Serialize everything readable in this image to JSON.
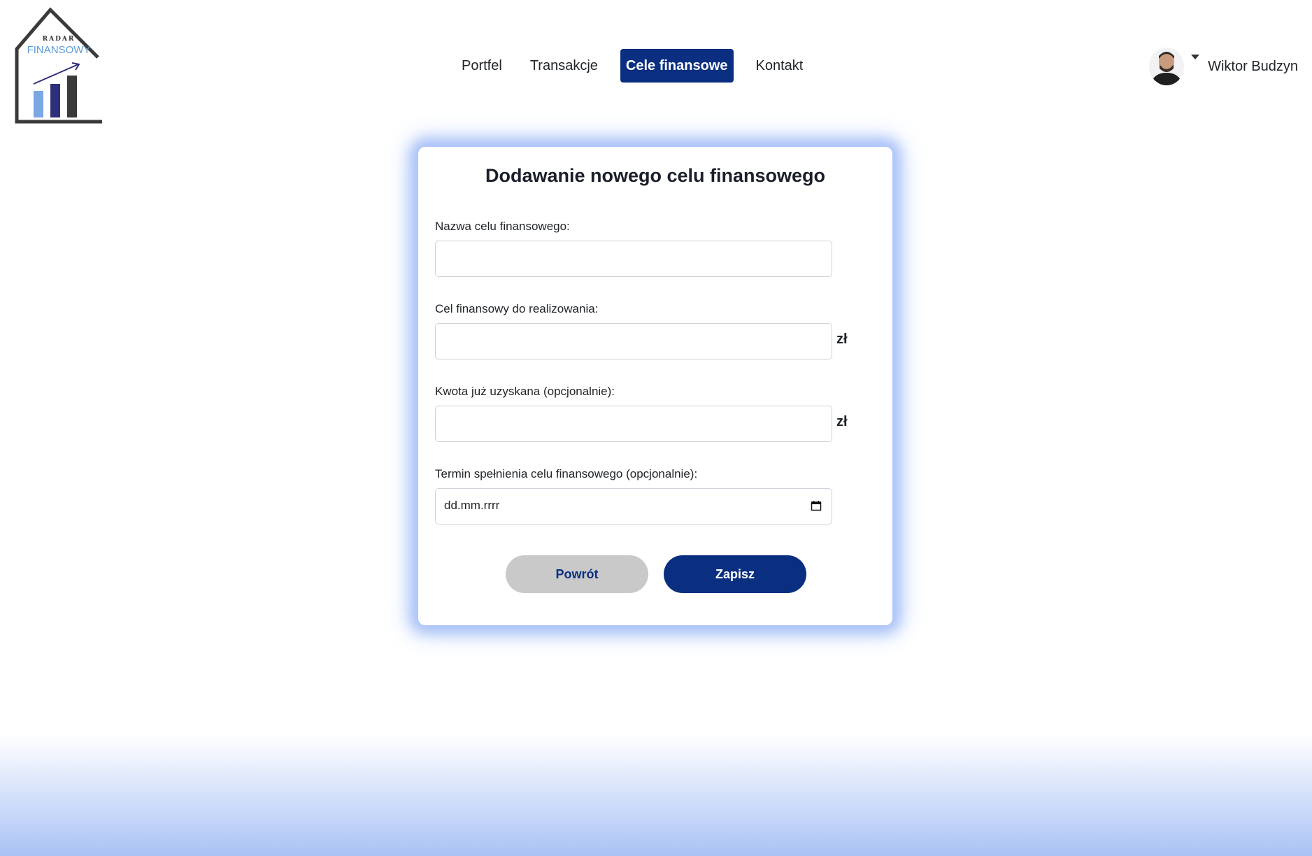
{
  "brand": {
    "logo_top_text": "RADAR",
    "logo_main_text": "FINANSOWY"
  },
  "nav": {
    "items": [
      {
        "label": "Portfel",
        "active": false
      },
      {
        "label": "Transakcje",
        "active": false
      },
      {
        "label": "Cele finansowe",
        "active": true
      },
      {
        "label": "Kontakt",
        "active": false
      }
    ]
  },
  "user": {
    "name": "Wiktor Budzyn",
    "avatar_icon": "user-avatar",
    "menu_icon": "caret-down-icon"
  },
  "form": {
    "title": "Dodawanie nowego celu finansowego",
    "goal_name": {
      "label": "Nazwa celu finansowego:",
      "value": ""
    },
    "target_amount": {
      "label": "Cel finansowy do realizowania:",
      "value": "",
      "currency": "zł"
    },
    "obtained_amount": {
      "label": "Kwota już uzyskana (opcjonalnie):",
      "value": "",
      "currency": "zł"
    },
    "deadline": {
      "label": "Termin spełnienia celu finansowego (opcjonalnie):",
      "placeholder": "dd.mm.rrrr",
      "icon": "calendar-icon"
    },
    "back_label": "Powrót",
    "save_label": "Zapisz"
  },
  "colors": {
    "primary": "#0a2f80",
    "secondary_button": "#c9c9c9",
    "card_glow": "#a8c1f7",
    "logo_accent": "#5b9bd5"
  }
}
